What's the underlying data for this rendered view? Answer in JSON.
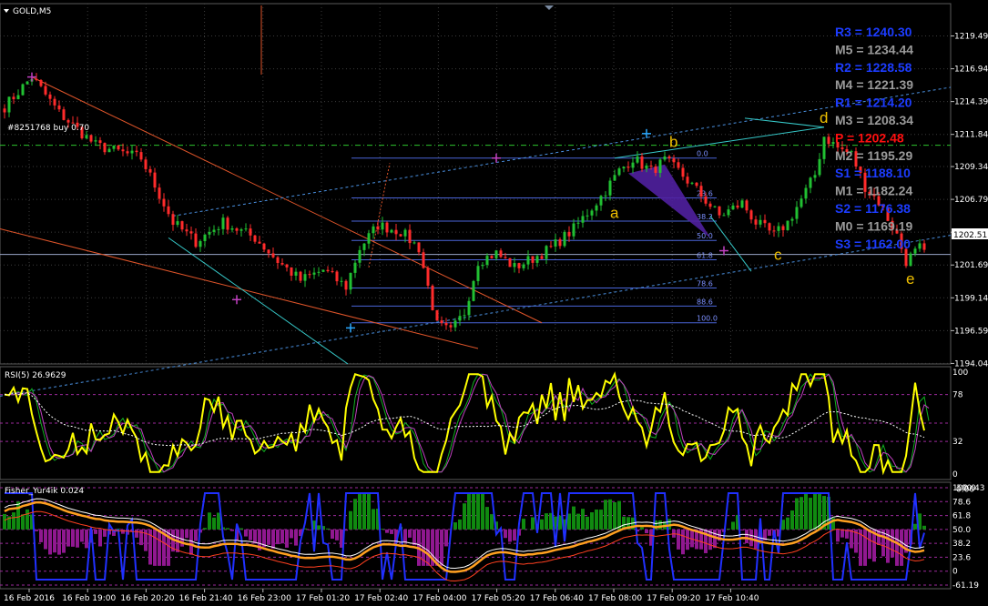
{
  "chart_data": [
    {
      "type": "candlestick",
      "title": "GOLD,M5",
      "ylim": [
        1194.0,
        1222.0
      ],
      "y_ticks": [
        "1219.49",
        "1216.94",
        "1214.39",
        "1211.84",
        "1209.34",
        "1206.79",
        "1204.24",
        "1201.69",
        "1199.14",
        "1196.59",
        "1194.04"
      ],
      "current_price": "1202.51",
      "x_ticks": [
        "16 Feb 2016",
        "16 Feb 19:00",
        "16 Feb 20:20",
        "16 Feb 21:40",
        "16 Feb 23:00",
        "17 Feb 01:20",
        "17 Feb 02:40",
        "17 Feb 04:00",
        "17 Feb 05:20",
        "17 Feb 06:40",
        "17 Feb 08:00",
        "17 Feb 09:20",
        "17 Feb 10:40"
      ],
      "order_label": "#8251768 buy 0.70",
      "order_price": 1211.0,
      "fib_levels": [
        {
          "label": "0.0",
          "price": 1210.0
        },
        {
          "label": "23.6",
          "price": 1206.9
        },
        {
          "label": "38.2",
          "price": 1205.1
        },
        {
          "label": "50.0",
          "price": 1203.6
        },
        {
          "label": "61.8",
          "price": 1202.1
        },
        {
          "label": "78.6",
          "price": 1199.9
        },
        {
          "label": "88.6",
          "price": 1198.5
        },
        {
          "label": "100.0",
          "price": 1197.2
        }
      ],
      "pivots": [
        {
          "name": "R3",
          "text": "R3 = 1240.30",
          "color": "#1c3cff"
        },
        {
          "name": "M5",
          "text": "M5 = 1234.44",
          "color": "#9a9a9a"
        },
        {
          "name": "R2",
          "text": "R2 = 1228.58",
          "color": "#1c3cff"
        },
        {
          "name": "M4",
          "text": "M4 = 1221.39",
          "color": "#9a9a9a"
        },
        {
          "name": "R1",
          "text": "R1 = 1214.20",
          "color": "#1c3cff"
        },
        {
          "name": "M3",
          "text": "M3 = 1208.34",
          "color": "#9a9a9a"
        },
        {
          "name": "P",
          "text": "P   = 1202.48",
          "color": "#ff1010"
        },
        {
          "name": "M2",
          "text": "M2 = 1195.29",
          "color": "#9a9a9a"
        },
        {
          "name": "S1",
          "text": "S1 = 1188.10",
          "color": "#1c3cff"
        },
        {
          "name": "M1",
          "text": "M1 = 1182.24",
          "color": "#9a9a9a"
        },
        {
          "name": "S2",
          "text": "S2 = 1176.38",
          "color": "#1c3cff"
        },
        {
          "name": "M0",
          "text": "M0 = 1169.19",
          "color": "#9a9a9a"
        },
        {
          "name": "S3",
          "text": "S3 = 1162.00",
          "color": "#1c3cff"
        }
      ],
      "pattern_points": [
        {
          "label": "a",
          "bar": 134,
          "price": 1207.2
        },
        {
          "label": "b",
          "bar": 147,
          "price": 1210.0
        },
        {
          "label": "c",
          "bar": 170,
          "price": 1203.8
        },
        {
          "label": "d",
          "bar": 180,
          "price": 1211.9
        },
        {
          "label": "e",
          "bar": 199,
          "price": 1200.5
        }
      ],
      "key_points": [
        [
          0,
          1214.0
        ],
        [
          6,
          1216.3
        ],
        [
          12,
          1213.5
        ],
        [
          20,
          1211.0
        ],
        [
          30,
          1210.0
        ],
        [
          37,
          1205.0
        ],
        [
          42,
          1203.5
        ],
        [
          48,
          1205.0
        ],
        [
          55,
          1203.8
        ],
        [
          60,
          1202.0
        ],
        [
          65,
          1200.5
        ],
        [
          70,
          1201.3
        ],
        [
          75,
          1200.0
        ],
        [
          78,
          1203.0
        ],
        [
          82,
          1204.8
        ],
        [
          87,
          1204.3
        ],
        [
          91,
          1203.0
        ],
        [
          95,
          1197.0
        ],
        [
          98,
          1196.5
        ],
        [
          101,
          1198.0
        ],
        [
          104,
          1202.0
        ],
        [
          108,
          1202.6
        ],
        [
          112,
          1201.5
        ],
        [
          116,
          1202.2
        ],
        [
          120,
          1203.0
        ],
        [
          125,
          1204.5
        ],
        [
          131,
          1207.0
        ],
        [
          135,
          1209.0
        ],
        [
          138,
          1210.0
        ],
        [
          142,
          1209.0
        ],
        [
          145,
          1209.8
        ],
        [
          148,
          1209.0
        ],
        [
          152,
          1207.5
        ],
        [
          157,
          1205.5
        ],
        [
          162,
          1206.5
        ],
        [
          165,
          1205.0
        ],
        [
          169,
          1204.0
        ],
        [
          172,
          1205.0
        ],
        [
          175,
          1206.8
        ],
        [
          178,
          1208.7
        ],
        [
          180,
          1211.7
        ],
        [
          183,
          1210.8
        ],
        [
          186,
          1210.3
        ],
        [
          189,
          1207.8
        ],
        [
          192,
          1206.6
        ],
        [
          196,
          1204.0
        ],
        [
          198,
          1202.0
        ],
        [
          201,
          1203.0
        ],
        [
          202,
          1202.5
        ]
      ]
    },
    {
      "type": "line",
      "title": "RSI(5) 26.9629",
      "ylim": [
        0,
        100
      ],
      "y_ticks": [
        "100",
        "78",
        "32",
        "0"
      ],
      "levels": [
        78,
        50,
        32
      ]
    },
    {
      "type": "histogram+line",
      "title": "Fisher_Yur4ik 0.024",
      "y_ticks": [
        "100.0",
        "78.6",
        "61.8",
        "50.0",
        "38.2",
        "23.6",
        "0",
        "-61.19"
      ],
      "y_tick_overlays": [
        "100.43",
        "0.00"
      ]
    }
  ],
  "colors": {
    "background": "#000000",
    "grid": "#3c3c3c",
    "candle_up": "#21c032",
    "candle_down": "#ff2b2b",
    "wick": "#c8c8c8",
    "fib": "#4a64d8",
    "channel_blue": "#4a90e0",
    "trend_orange": "#e0552a",
    "cyan_line": "#36c9c9",
    "order_line": "#2ec42e",
    "pattern_fill": "#5020a0",
    "rsi_main": "#ffff00",
    "rsi_green": "#10b020",
    "rsi_purple": "#c040c0",
    "fisher_blue": "#2030ff",
    "fisher_orange": "#ffa020",
    "fisher_hist_up": "#108a10",
    "fisher_hist_down": "#901890"
  }
}
